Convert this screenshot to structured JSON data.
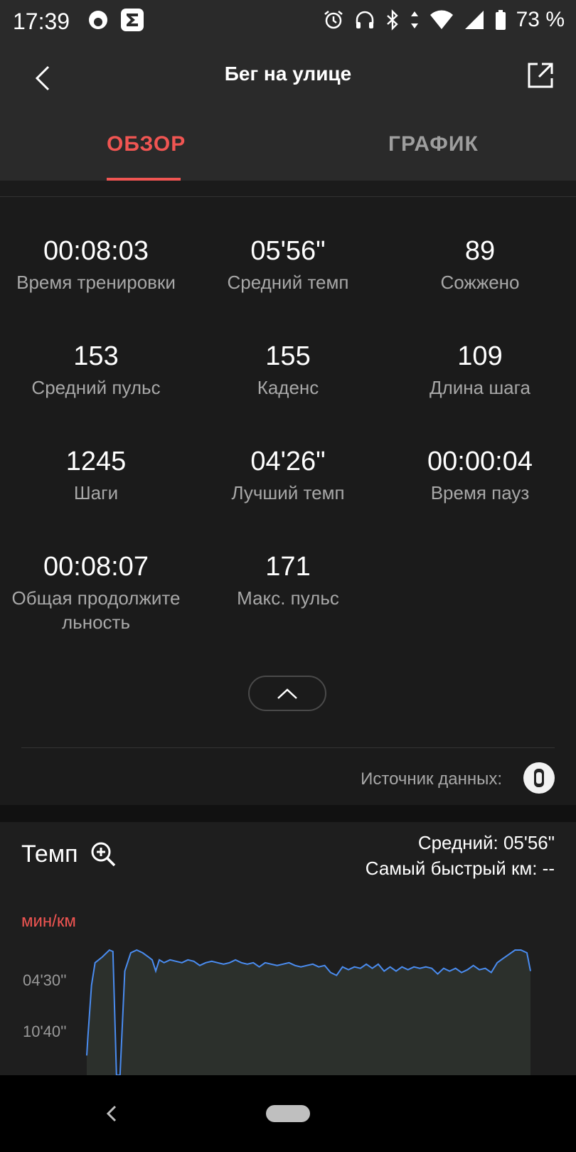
{
  "status_bar": {
    "time": "17:39",
    "battery_text": "73 %",
    "icons": [
      "app-circle-icon",
      "sigma-app-icon",
      "alarm-icon",
      "headphones-icon",
      "bluetooth-icon",
      "data-arrows-icon",
      "wifi-icon",
      "signal-icon",
      "battery-icon"
    ]
  },
  "header": {
    "title": "Бег на улице",
    "back_icon": "back-chevron-icon",
    "share_icon": "share-icon"
  },
  "tabs": [
    {
      "label": "ОБЗОР",
      "active": true
    },
    {
      "label": "ГРАФИК",
      "active": false
    }
  ],
  "accent_color": "#f05552",
  "stats": [
    {
      "value": "00:08:03",
      "label": "Время тренировки"
    },
    {
      "value": "05'56\"",
      "label": "Средний темп"
    },
    {
      "value": "89",
      "label": "Сожжено"
    },
    {
      "value": "153",
      "label": "Средний пульс"
    },
    {
      "value": "155",
      "label": "Каденс"
    },
    {
      "value": "109",
      "label": "Длина шага"
    },
    {
      "value": "1245",
      "label": "Шаги"
    },
    {
      "value": "04'26\"",
      "label": "Лучший темп"
    },
    {
      "value": "00:00:04",
      "label": "Время пауз"
    },
    {
      "value": "00:08:07",
      "label": "Общая продолжите льность"
    },
    {
      "value": "171",
      "label": "Макс. пульс"
    }
  ],
  "source": {
    "label": "Источник данных:"
  },
  "pace_card": {
    "title": "Темп",
    "average": "Средний: 05'56\"",
    "fastest_km": "Самый быстрый км: --",
    "unit": "мин/км",
    "ticks": [
      "04'30''",
      "10'40''"
    ]
  },
  "chart_data": {
    "type": "area",
    "title": "Темп",
    "ylabel": "мин/км",
    "y_tick_labels": [
      "04'30''",
      "10'40''"
    ],
    "series": [
      {
        "color": "#4a8cf0",
        "values": [
          [
            0.0,
            11.6
          ],
          [
            0.2,
            10.2
          ],
          [
            0.8,
            6.6
          ],
          [
            1.4,
            5.0
          ],
          [
            2.6,
            4.6
          ],
          [
            3.8,
            4.1
          ],
          [
            4.4,
            4.2
          ],
          [
            5.0,
            13.0
          ],
          [
            5.6,
            13.0
          ],
          [
            6.4,
            5.6
          ],
          [
            7.4,
            4.3
          ],
          [
            8.4,
            4.1
          ],
          [
            9.4,
            4.3
          ],
          [
            10.4,
            4.6
          ],
          [
            11.0,
            4.8
          ],
          [
            11.6,
            5.6
          ],
          [
            12.2,
            4.8
          ],
          [
            13.0,
            5.0
          ],
          [
            14.0,
            4.8
          ],
          [
            15.0,
            4.9
          ],
          [
            16.0,
            5.0
          ],
          [
            17.0,
            4.8
          ],
          [
            18.0,
            4.9
          ],
          [
            19.0,
            5.2
          ],
          [
            20.0,
            5.0
          ],
          [
            21.0,
            4.9
          ],
          [
            22.0,
            5.0
          ],
          [
            23.0,
            5.1
          ],
          [
            24.0,
            5.0
          ],
          [
            25.0,
            4.8
          ],
          [
            26.0,
            5.0
          ],
          [
            27.0,
            5.1
          ],
          [
            28.0,
            5.0
          ],
          [
            29.0,
            5.3
          ],
          [
            30.0,
            5.0
          ],
          [
            31.0,
            5.1
          ],
          [
            32.0,
            5.2
          ],
          [
            33.0,
            5.1
          ],
          [
            34.0,
            5.0
          ],
          [
            35.0,
            5.2
          ],
          [
            36.0,
            5.3
          ],
          [
            37.0,
            5.2
          ],
          [
            38.0,
            5.1
          ],
          [
            39.0,
            5.3
          ],
          [
            40.0,
            5.2
          ],
          [
            41.0,
            5.7
          ],
          [
            42.0,
            5.9
          ],
          [
            43.0,
            5.3
          ],
          [
            44.0,
            5.5
          ],
          [
            45.0,
            5.3
          ],
          [
            46.0,
            5.4
          ],
          [
            47.0,
            5.1
          ],
          [
            48.0,
            5.4
          ],
          [
            49.0,
            5.1
          ],
          [
            50.0,
            5.6
          ],
          [
            51.0,
            5.3
          ],
          [
            52.0,
            5.6
          ],
          [
            53.0,
            5.3
          ],
          [
            54.0,
            5.5
          ],
          [
            55.0,
            5.3
          ],
          [
            56.0,
            5.4
          ],
          [
            57.0,
            5.3
          ],
          [
            58.0,
            5.4
          ],
          [
            59.0,
            5.8
          ],
          [
            60.0,
            5.4
          ],
          [
            61.0,
            5.6
          ],
          [
            62.0,
            5.4
          ],
          [
            63.0,
            5.7
          ],
          [
            64.0,
            5.5
          ],
          [
            65.0,
            5.2
          ],
          [
            66.0,
            5.5
          ],
          [
            67.0,
            5.4
          ],
          [
            68.0,
            5.7
          ],
          [
            69.0,
            5.0
          ],
          [
            70.0,
            4.7
          ],
          [
            71.0,
            4.4
          ],
          [
            72.0,
            4.1
          ],
          [
            73.0,
            4.1
          ],
          [
            74.0,
            4.3
          ],
          [
            74.6,
            5.6
          ]
        ]
      }
    ]
  }
}
